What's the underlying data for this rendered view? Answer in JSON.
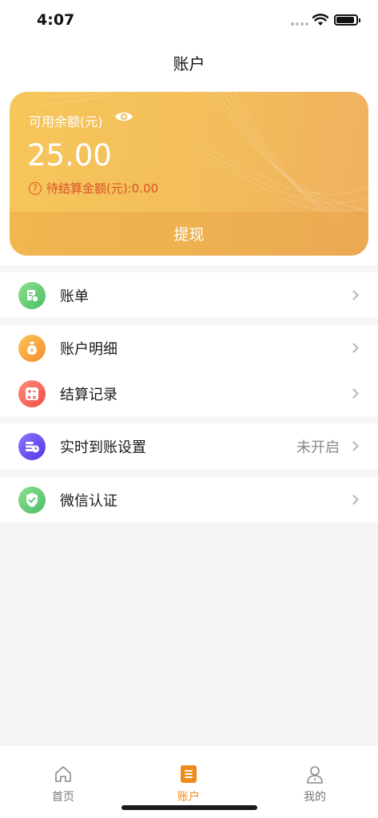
{
  "status_bar": {
    "time": "4:07"
  },
  "header": {
    "title": "账户"
  },
  "balance_card": {
    "label": "可用余额(元)",
    "amount": "25.00",
    "pending_text": "待结算金额(元):0.00",
    "withdraw_label": "提现"
  },
  "menu": {
    "bill": {
      "label": "账单",
      "icon": "bill-icon",
      "color": "#5cc870"
    },
    "detail": {
      "label": "账户明细",
      "icon": "money-bag-icon",
      "color": "#f6a13c"
    },
    "settlement": {
      "label": "结算记录",
      "icon": "calculator-icon",
      "color": "#f0604e"
    },
    "realtime": {
      "label": "实时到账设置",
      "value": "未开启",
      "icon": "coins-clock-icon",
      "color": "#6a4cf0"
    },
    "wechat": {
      "label": "微信认证",
      "icon": "shield-check-icon",
      "color": "#5cc870"
    }
  },
  "tabbar": {
    "home": {
      "label": "首页",
      "icon": "home-icon"
    },
    "account": {
      "label": "账户",
      "icon": "account-icon",
      "active": true
    },
    "mine": {
      "label": "我的",
      "icon": "user-icon"
    }
  },
  "colors": {
    "accent": "#ef8a1d",
    "card_gradient_start": "#f6c659",
    "card_gradient_end": "#efb05f",
    "pending_text": "#d9522a"
  }
}
